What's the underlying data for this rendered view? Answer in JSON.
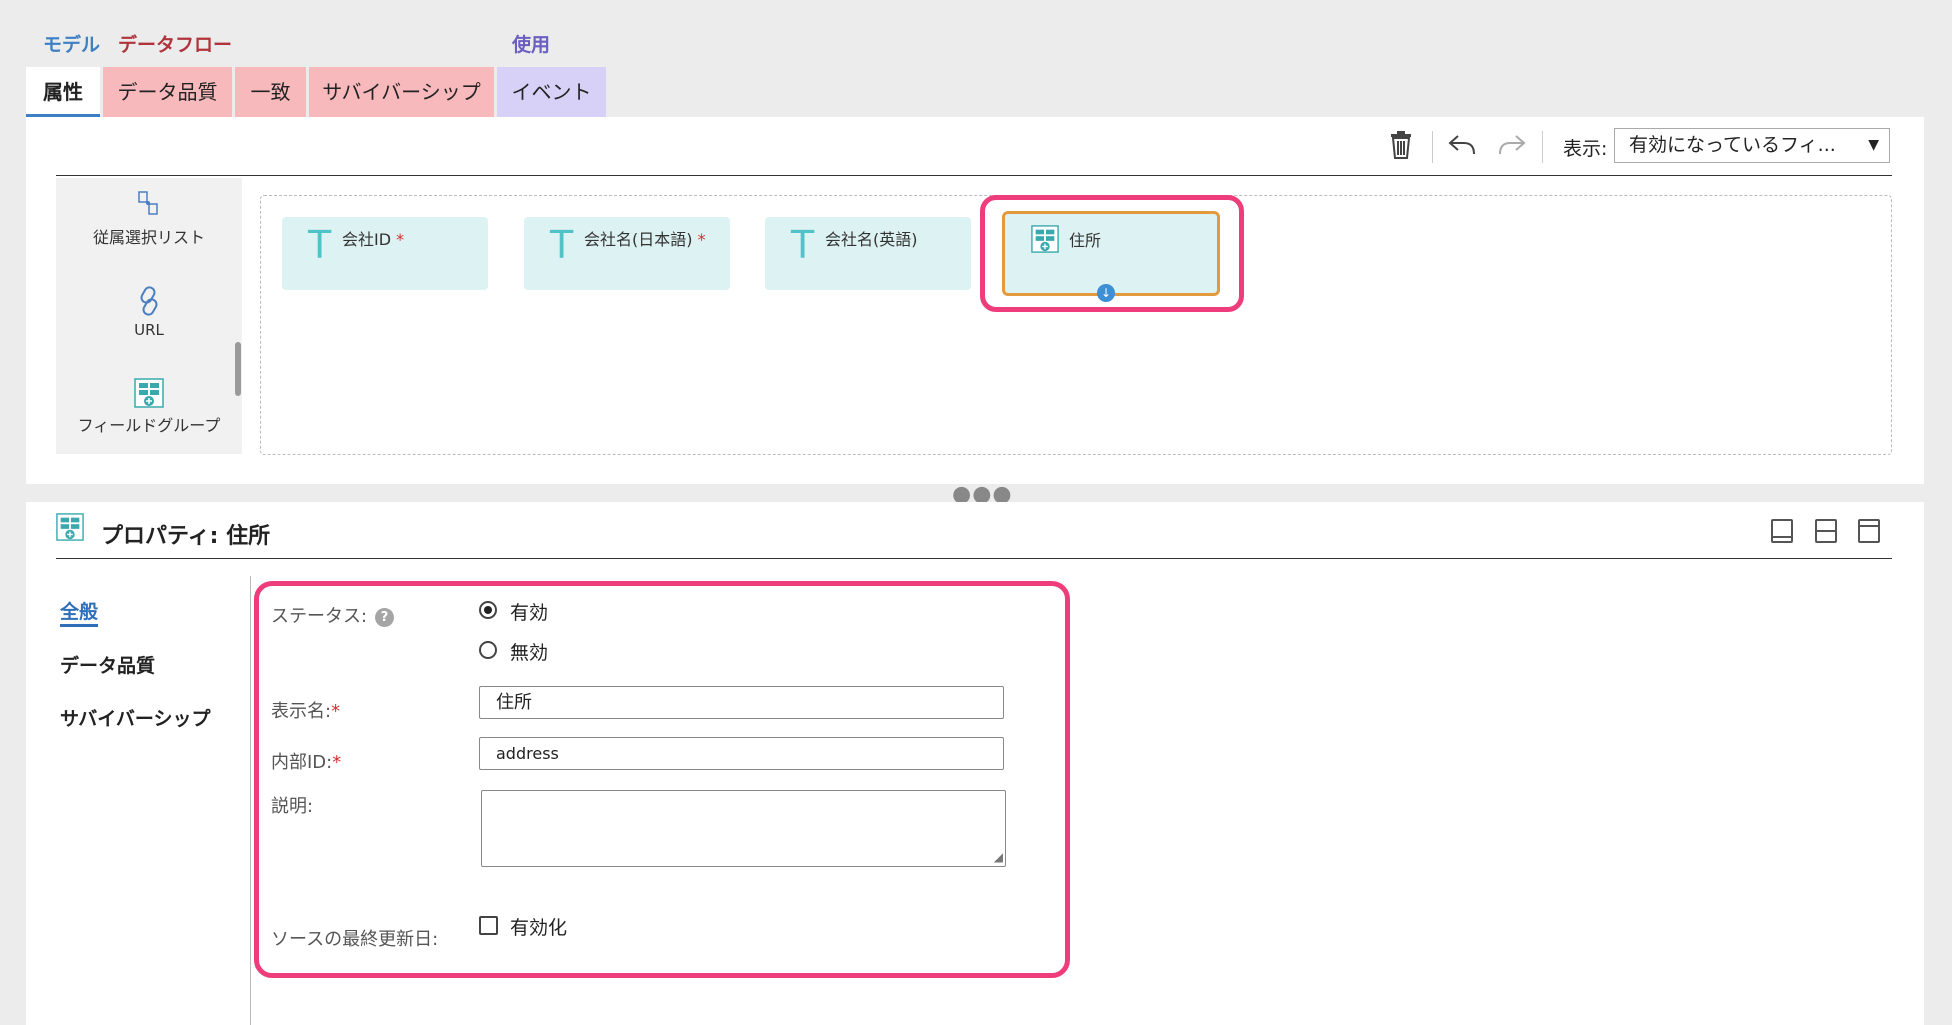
{
  "groups": {
    "model": "モデル",
    "dataflow": "データフロー",
    "use": "使用"
  },
  "colors": {
    "model": "#3d7fc5",
    "dataflow": "#b0343c",
    "use": "#6a5fbf",
    "highlight": "#ee3d7a",
    "selected_border": "#e39a3c",
    "field_bg": "#ddf2f2"
  },
  "tabs": [
    {
      "label": "属性",
      "group": "model",
      "active": true
    },
    {
      "label": "データ品質",
      "group": "dataflow"
    },
    {
      "label": "一致",
      "group": "dataflow"
    },
    {
      "label": "サバイバーシップ",
      "group": "dataflow"
    },
    {
      "label": "イベント",
      "group": "use"
    }
  ],
  "toolbar": {
    "icons": [
      "trash-icon",
      "undo-icon",
      "redo-icon"
    ],
    "view_label": "表示:",
    "view_value": "有効になっているフィ..."
  },
  "palette": [
    {
      "label": "従属選択リスト",
      "icon": "dependent-picklist-icon"
    },
    {
      "label": "URL",
      "icon": "link-icon"
    },
    {
      "label": "フィールドグループ",
      "icon": "field-group-icon"
    }
  ],
  "fields": [
    {
      "name": "会社ID",
      "required": true
    },
    {
      "name": "会社名(日本語)",
      "required": true
    },
    {
      "name": "会社名(英語)",
      "required": false
    }
  ],
  "selected_group": {
    "name": "住所"
  },
  "properties": {
    "title": "プロパティ: 住所",
    "sidebar": [
      "全般",
      "データ品質",
      "サバイバーシップ"
    ],
    "status_label": "ステータス:",
    "status_options": [
      "有効",
      "無効"
    ],
    "status_selected": "有効",
    "display_name_label": "表示名:",
    "display_name_value": "住所",
    "internal_id_label": "内部ID:",
    "internal_id_value": "address",
    "description_label": "説明:",
    "source_updated_label": "ソースの最終更新日:",
    "source_updated_checkbox": "有効化",
    "required_mark": "*"
  }
}
